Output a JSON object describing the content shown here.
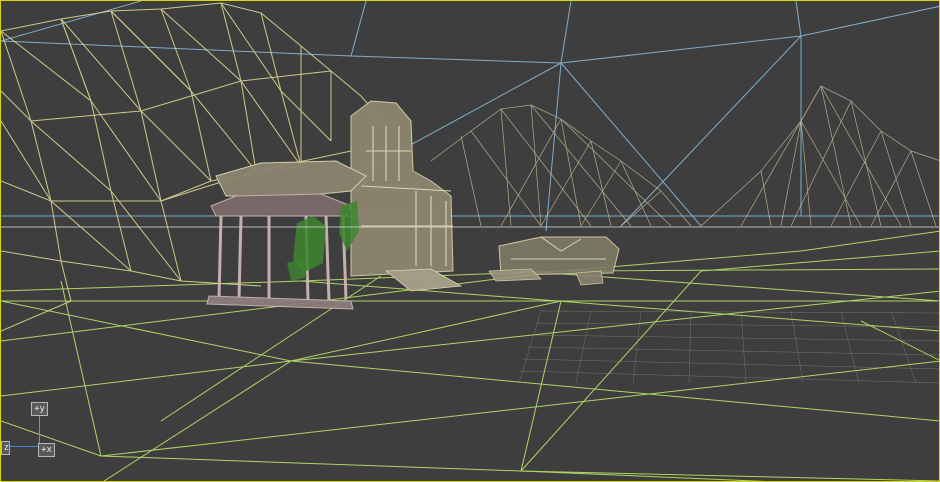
{
  "viewport": {
    "kind": "3d-perspective-wireframe",
    "background_color": "#3e3e3e",
    "border_color": "#d8d800",
    "colors": {
      "terrain_wire": "#e6e29a",
      "ground_wire": "#b8e06a",
      "sky_wire": "#8ab8d8",
      "building": "#d2cba6",
      "foliage": "#3d8a2e"
    }
  },
  "axis_gizmo": {
    "y_label": "+y",
    "x_label": "+x",
    "z_label": "z",
    "y_color": "#2fd02f",
    "x_color": "#e04040",
    "z_color": "#4a7ae6"
  }
}
